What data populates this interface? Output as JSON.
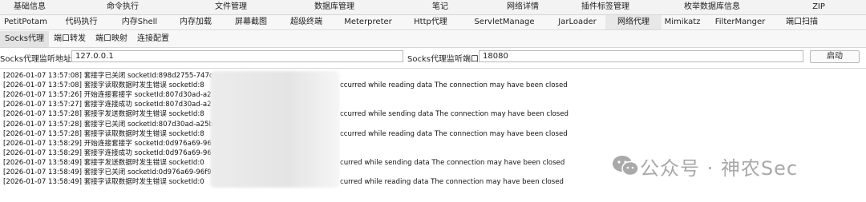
{
  "main_tabs": [
    "基础信息",
    "命令执行",
    "文件管理",
    "数据库管理",
    "笔记",
    "网络详情",
    "插件标签管理",
    "枚举数据库信息",
    "ZIP"
  ],
  "plugin_tabs": [
    {
      "label": "PetitPotam"
    },
    {
      "label": "代码执行"
    },
    {
      "label": "内存Shell"
    },
    {
      "label": "内存加载"
    },
    {
      "label": "屏幕截图"
    },
    {
      "label": "超级终端"
    },
    {
      "label": "Meterpreter"
    },
    {
      "label": "Http代理"
    },
    {
      "label": "ServletManage"
    },
    {
      "label": "JarLoader"
    },
    {
      "label": "网络代理",
      "active": true
    },
    {
      "label": "Mimikatz"
    },
    {
      "label": "FilterManger"
    },
    {
      "label": "端口扫描"
    }
  ],
  "sub_tabs": [
    {
      "label": "Socks代理",
      "active": true
    },
    {
      "label": "端口转发"
    },
    {
      "label": "端口映射"
    },
    {
      "label": "连接配置"
    }
  ],
  "config": {
    "address_label": "Socks代理监听地址:",
    "address_value": "127.0.0.1",
    "port_label": "Socks代理监听端口:",
    "port_value": "18080",
    "start_button": "启动"
  },
  "log_lines": [
    {
      "text": "[2026-01-07 13:57:08] 套接字已关闭 socketId:898d2755-747c",
      "tail": ""
    },
    {
      "text": "[2026-01-07 13:57:08] 套接字读取数据时发生错误  socketId:8",
      "tail": "ccurred while reading data The connection may have been closed"
    },
    {
      "text": "[2026-01-07 13:57:26] 开始连接套接字 socketId:807d30ad-a2",
      "tail": ""
    },
    {
      "text": "[2026-01-07 13:57:27] 套接字连接成功 socketId:807d30ad-a2",
      "tail": ""
    },
    {
      "text": "[2026-01-07 13:57:28] 套接字发送数据时发生错误  socketId:8",
      "tail": "ccurred while sending data The connection may have been closed"
    },
    {
      "text": "[2026-01-07 13:57:28] 套接字已关闭 socketId:807d30ad-a25b",
      "tail": ""
    },
    {
      "text": "[2026-01-07 13:57:28] 套接字读取数据时发生错误  socketId:8",
      "tail": "ccurred while reading data The connection may have been closed"
    },
    {
      "text": "[2026-01-07 13:58:29] 开始连接套接字 socketId:0d976a69-96",
      "tail": ""
    },
    {
      "text": "[2026-01-07 13:58:29] 套接字连接成功 socketId:0d976a69-96",
      "tail": ""
    },
    {
      "text": "[2026-01-07 13:58:49] 套接字发送数据时发生错误  socketId:0",
      "tail": "curred while sending data The connection may have been closed"
    },
    {
      "text": "[2026-01-07 13:58:49] 套接字已关闭 socketId:0d976a69-96f9",
      "tail": ""
    },
    {
      "text": "[2026-01-07 13:58:49] 套接字读取数据时发生错误  socketId:0",
      "tail": "curred while reading data The connection may have been closed"
    }
  ],
  "watermark": {
    "text": "公众号 · 神农Sec",
    "icon": "wechat-icon",
    "color": "#a9a9a9"
  },
  "colors": {
    "active_tab": "#e8e8e8",
    "border": "#d6d6d6"
  }
}
